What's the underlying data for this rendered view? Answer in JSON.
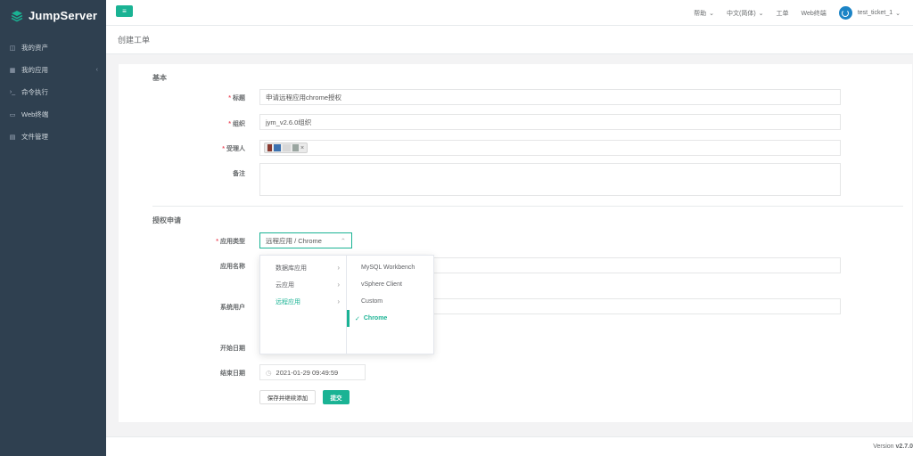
{
  "brand": {
    "name": "JumpServer"
  },
  "sidebar": {
    "items": [
      {
        "label": "我的资产",
        "icon": "cube-icon"
      },
      {
        "label": "我的应用",
        "icon": "grid-icon",
        "has_caret": true
      },
      {
        "label": "命令执行",
        "icon": "terminal-icon"
      },
      {
        "label": "Web终端",
        "icon": "window-icon"
      },
      {
        "label": "文件管理",
        "icon": "file-icon"
      }
    ]
  },
  "topbar": {
    "menu_icon": "≡",
    "help": "帮助",
    "language": "中文(简体)",
    "tickets": "工单",
    "web_terminal": "Web终端",
    "user": "test_ticket_1"
  },
  "page": {
    "title": "创建工单"
  },
  "form": {
    "section_basic": "基本",
    "title_label": "标题",
    "title_value": "申请远程应用chrome授权",
    "org_label": "组织",
    "org_value": "jym_v2.6.0组织",
    "assignee_label": "受理人",
    "assignee_tag_remove": "×",
    "remark_label": "备注",
    "section_request": "授权申请",
    "app_type_label": "应用类型",
    "app_type_value": "远程应用 / Chrome",
    "app_name_label": "应用名称",
    "system_user_label": "系统用户",
    "start_date_label": "开始日期",
    "end_date_label": "结束日期",
    "end_date_value": "2021-01-29 09:49:59",
    "save_continue": "保存并继续添加",
    "submit": "提交",
    "required_mark": "*"
  },
  "cascader": {
    "level1": [
      {
        "label": "数据库应用",
        "arrow": "›"
      },
      {
        "label": "云应用",
        "arrow": "›"
      },
      {
        "label": "远程应用",
        "arrow": "›",
        "active": true
      }
    ],
    "level2": [
      {
        "label": "MySQL Workbench"
      },
      {
        "label": "vSphere Client"
      },
      {
        "label": "Custom"
      },
      {
        "label": "Chrome",
        "active": true,
        "check": "✓"
      }
    ]
  },
  "footer": {
    "version_prefix": "Version",
    "version": "v2.7.0"
  },
  "colors": {
    "accent": "#1ab394",
    "sidebar": "#2f4050",
    "required": "#ed5565"
  }
}
